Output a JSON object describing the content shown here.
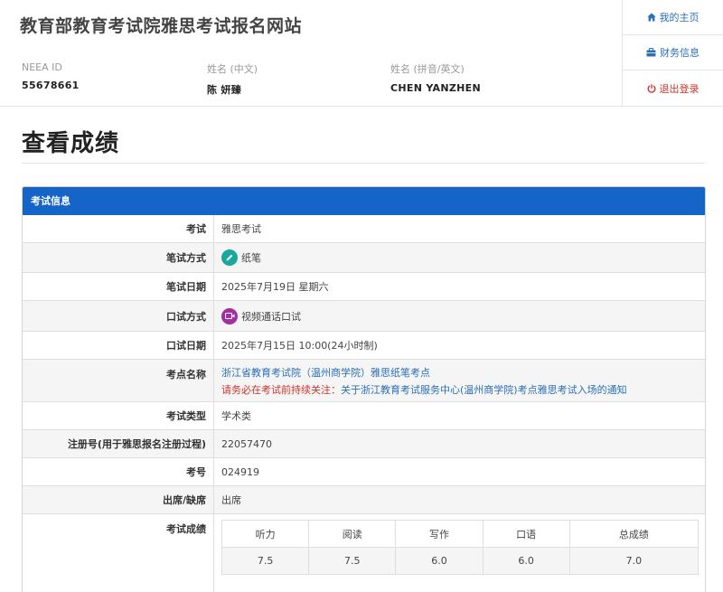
{
  "header": {
    "site_title": "教育部教育考试院雅思考试报名网站",
    "neea_label": "NEEA ID",
    "neea_value": "55678661",
    "name_cn_label": "姓名 (中文)",
    "name_cn_value": "陈 妍臻",
    "name_en_label": "姓名 (拼音/英文)",
    "name_en_value": "CHEN YANZHEN"
  },
  "nav": {
    "home": "我的主页",
    "finance": "财务信息",
    "logout": "退出登录"
  },
  "page_title": "查看成绩",
  "panel": {
    "heading": "考试信息",
    "rows": {
      "exam_label": "考试",
      "exam_value": "雅思考试",
      "written_method_label": "笔试方式",
      "written_method_value": "纸笔",
      "written_date_label": "笔试日期",
      "written_date_value": "2025年7月19日 星期六",
      "oral_method_label": "口试方式",
      "oral_method_value": "视频通话口试",
      "oral_date_label": "口试日期",
      "oral_date_value": "2025年7月15日 10:00(24小时制)",
      "venue_label": "考点名称",
      "venue_link": "浙江省教育考试院（温州商学院）雅思纸笔考点",
      "venue_notice_red": "请务必在考试前持续关注：",
      "venue_notice_link": "关于浙江教育考试服务中心(温州商学院)考点雅思考试入场的通知",
      "exam_type_label": "考试类型",
      "exam_type_value": "学术类",
      "reg_label": "注册号(用于雅思报名注册过程)",
      "reg_value": "22057470",
      "candidate_label": "考号",
      "candidate_value": "024919",
      "attendance_label": "出席/缺席",
      "attendance_value": "出席",
      "score_label": "考试成绩"
    },
    "scores": {
      "headers": [
        "听力",
        "阅读",
        "写作",
        "口语",
        "总成绩"
      ],
      "values": [
        "7.5",
        "7.5",
        "6.0",
        "6.0",
        "7.0"
      ]
    }
  },
  "icons": {
    "home": "home-icon",
    "finance": "briefcase-icon",
    "logout": "power-icon",
    "written": "pencil-icon",
    "oral": "video-icon"
  },
  "colors": {
    "panel_header": "#1565c9",
    "link": "#2a6fb8",
    "warning": "#d0332a",
    "pencil_badge": "#1aa89a",
    "video_badge": "#a12fa0"
  }
}
